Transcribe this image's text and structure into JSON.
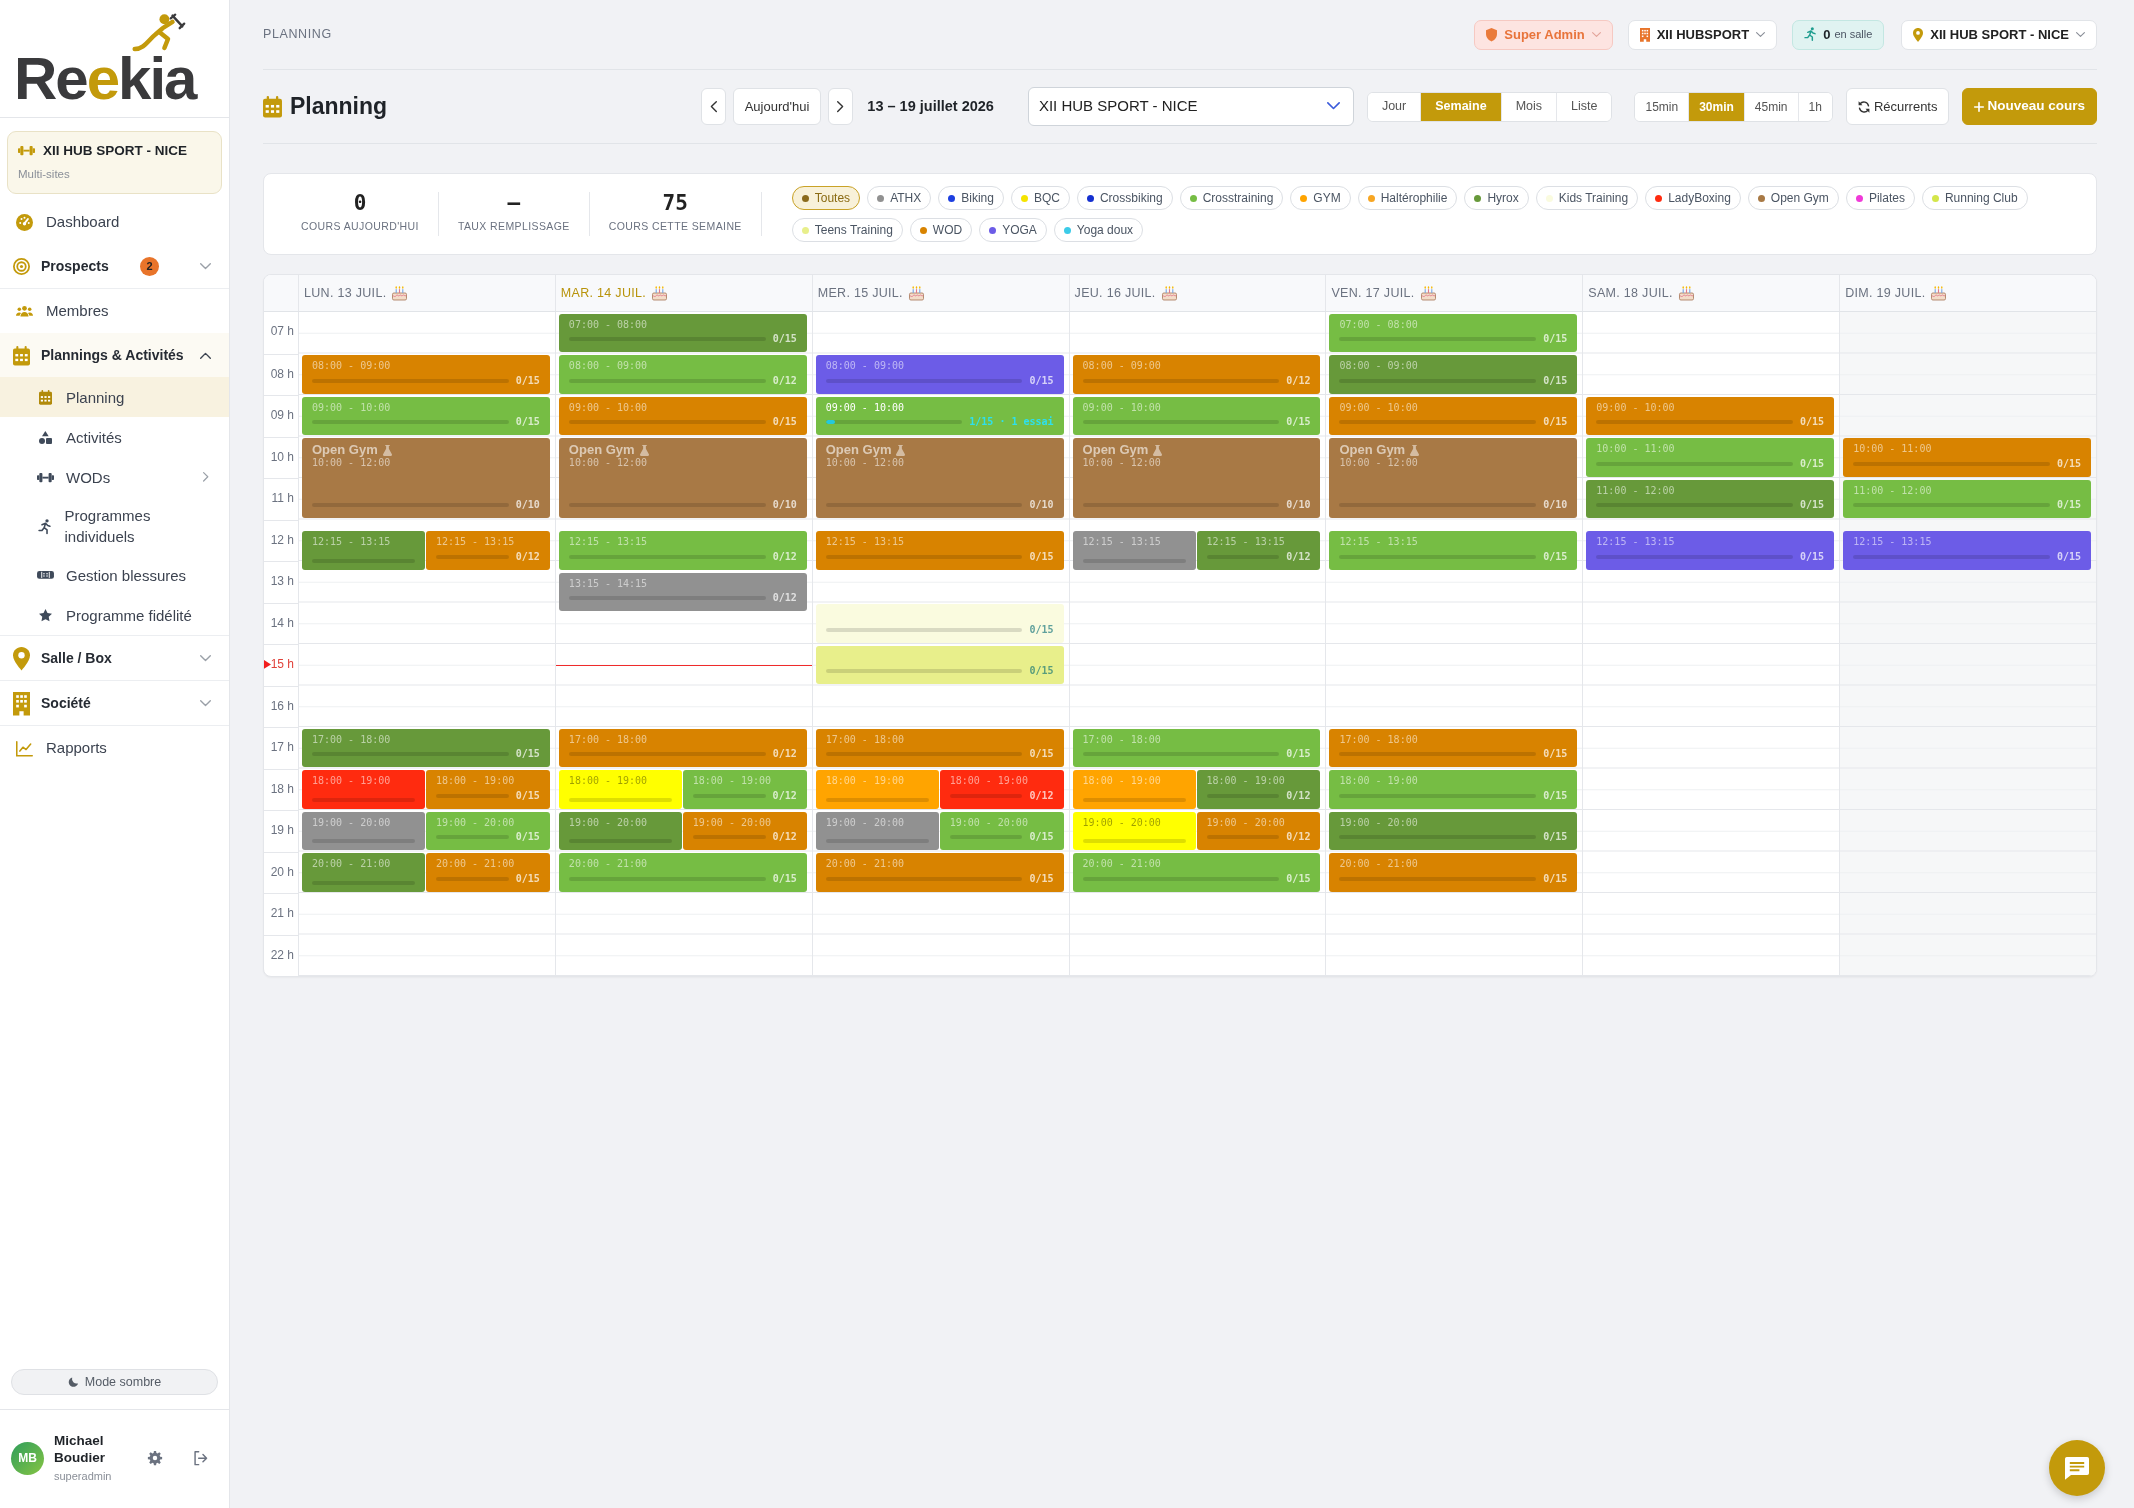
{
  "sidebar": {
    "logo": "Reekia",
    "site": {
      "name": "XII HUB SPORT - NICE",
      "subtitle": "Multi-sites"
    },
    "items": [
      {
        "kind": "link",
        "label": "Dashboard",
        "selected": false
      },
      {
        "kind": "group",
        "label": "Prospects",
        "badge": "2",
        "expanded": false,
        "selected": false
      },
      {
        "kind": "link",
        "label": "Membres",
        "selected": false
      },
      {
        "kind": "group",
        "label": "Plannings & Activités",
        "expanded": true,
        "selected": false,
        "children": [
          {
            "kind": "link",
            "label": "Planning",
            "selected": true
          },
          {
            "kind": "link",
            "label": "Activités",
            "selected": false
          },
          {
            "kind": "submenu",
            "label": "WODs",
            "selected": false
          },
          {
            "kind": "link",
            "label": "Programmes individuels",
            "selected": false
          },
          {
            "kind": "link",
            "label": "Gestion blessures",
            "selected": false
          },
          {
            "kind": "link",
            "label": "Programme fidélité",
            "selected": false
          }
        ]
      },
      {
        "kind": "group",
        "label": "Salle / Box",
        "expanded": false,
        "selected": false
      },
      {
        "kind": "group",
        "label": "Société",
        "expanded": false,
        "selected": false
      },
      {
        "kind": "link",
        "label": "Rapports",
        "selected": false
      }
    ],
    "dark_mode_button": "Mode sombre",
    "user": {
      "initials": "MB",
      "name": "Michael Boudier",
      "role": "superadmin"
    }
  },
  "topbar": {
    "breadcrumb": "PLANNING",
    "role": "Super Admin",
    "organization": "XII HUBSPORT",
    "presence": {
      "count": "0",
      "label": "en salle"
    },
    "site": "XII HUB SPORT - NICE"
  },
  "header": {
    "title": "Planning",
    "today_button": "Aujourd'hui",
    "range": "13 – 19 juillet 2026",
    "site_select": "XII HUB SPORT - NICE",
    "views": [
      {
        "label": "Jour",
        "selected": false
      },
      {
        "label": "Semaine",
        "selected": true
      },
      {
        "label": "Mois",
        "selected": false
      },
      {
        "label": "Liste",
        "selected": false
      }
    ],
    "intervals": [
      {
        "label": "15min",
        "selected": false
      },
      {
        "label": "30min",
        "selected": true
      },
      {
        "label": "45min",
        "selected": false
      },
      {
        "label": "1h",
        "selected": false
      }
    ],
    "recurring_button": "Récurrents",
    "new_button": "Nouveau cours"
  },
  "stats": [
    {
      "value": "0",
      "label": "COURS AUJOURD'HUI"
    },
    {
      "value": "–",
      "label": "TAUX REMPLISSAGE"
    },
    {
      "value": "75",
      "label": "COURS CETTE SEMAINE"
    }
  ],
  "filters": [
    {
      "label": "Toutes",
      "color": "#8a6a1c",
      "selected": true
    },
    {
      "label": "ATHX",
      "color": "#919191",
      "selected": false
    },
    {
      "label": "Biking",
      "color": "#1d3fe0",
      "selected": false
    },
    {
      "label": "BQC",
      "color": "#f5e400",
      "selected": false
    },
    {
      "label": "Crossbiking",
      "color": "#1530d0",
      "selected": false
    },
    {
      "label": "Crosstraining",
      "color": "#76bd44",
      "selected": false
    },
    {
      "label": "GYM",
      "color": "#ffa400",
      "selected": false
    },
    {
      "label": "Haltérophilie",
      "color": "#f7a623",
      "selected": false
    },
    {
      "label": "Hyrox",
      "color": "#67993a",
      "selected": false
    },
    {
      "label": "Kids Training",
      "color": "#fafbdf",
      "selected": false
    },
    {
      "label": "LadyBoxing",
      "color": "#ff2b0f",
      "selected": false
    },
    {
      "label": "Open Gym",
      "color": "#a87945",
      "selected": false
    },
    {
      "label": "Pilates",
      "color": "#f03ad8",
      "selected": false
    },
    {
      "label": "Running Club",
      "color": "#d4e64a",
      "selected": false
    },
    {
      "label": "Teens Training",
      "color": "#e8ef8b",
      "selected": false
    },
    {
      "label": "WOD",
      "color": "#d88300",
      "selected": false
    },
    {
      "label": "YOGA",
      "color": "#6c5ce7",
      "selected": false
    },
    {
      "label": "Yoga doux",
      "color": "#3ccbe8",
      "selected": false
    }
  ],
  "calendar": {
    "hours": [
      {
        "label": "07 h",
        "current": false
      },
      {
        "label": "08 h",
        "current": false
      },
      {
        "label": "09 h",
        "current": false
      },
      {
        "label": "10 h",
        "current": false
      },
      {
        "label": "11 h",
        "current": false
      },
      {
        "label": "12 h",
        "current": false
      },
      {
        "label": "13 h",
        "current": false
      },
      {
        "label": "14 h",
        "current": false
      },
      {
        "label": "15 h",
        "current": true
      },
      {
        "label": "16 h",
        "current": false
      },
      {
        "label": "17 h",
        "current": false
      },
      {
        "label": "18 h",
        "current": false
      },
      {
        "label": "19 h",
        "current": false
      },
      {
        "label": "20 h",
        "current": false
      },
      {
        "label": "21 h",
        "current": false
      },
      {
        "label": "22 h",
        "current": false
      }
    ],
    "days": [
      {
        "label": "LUN. 13 JUIL.",
        "today": false,
        "dimmed": false,
        "events": [
          {
            "color": "#d88300",
            "time": "08:00 - 09:00",
            "capacity": "0/15"
          },
          {
            "color": "#76bd44",
            "time": "09:00 - 10:00",
            "capacity": "0/15"
          },
          {
            "color": "#a87945",
            "title": "Open Gym",
            "time": "10:00 - 12:00",
            "capacity": "0/10"
          },
          {
            "color": "#67993a",
            "time": "12:15 - 13:15"
          },
          {
            "color": "#d88300",
            "time": "12:15 - 13:15",
            "capacity": "0/12"
          },
          {
            "color": "#67993a",
            "time": "17:00 - 18:00",
            "capacity": "0/15"
          },
          {
            "color": "#ff2b0f",
            "time": "18:00 - 19:00"
          },
          {
            "color": "#d88300",
            "time": "18:00 - 19:00",
            "capacity": "0/15"
          },
          {
            "color": "#919191",
            "time": "19:00 - 20:00"
          },
          {
            "color": "#76bd44",
            "time": "19:00 - 20:00",
            "capacity": "0/15"
          },
          {
            "color": "#67993a",
            "time": "20:00 - 21:00"
          },
          {
            "color": "#d88300",
            "time": "20:00 - 21:00",
            "capacity": "0/15"
          }
        ]
      },
      {
        "label": "MAR. 14 JUIL.",
        "today": true,
        "dimmed": false,
        "events": [
          {
            "color": "#67993a",
            "time": "07:00 - 08:00",
            "capacity": "0/15"
          },
          {
            "color": "#76bd44",
            "time": "08:00 - 09:00",
            "capacity": "0/12"
          },
          {
            "color": "#d88300",
            "time": "09:00 - 10:00",
            "capacity": "0/15"
          },
          {
            "color": "#a87945",
            "title": "Open Gym",
            "time": "10:00 - 12:00",
            "capacity": "0/10"
          },
          {
            "color": "#76bd44",
            "time": "12:15 - 13:15",
            "capacity": "0/12"
          },
          {
            "color": "#919191",
            "time": "13:15 - 14:15",
            "capacity": "0/12"
          },
          {
            "color": "#d88300",
            "time": "17:00 - 18:00",
            "capacity": "0/12"
          },
          {
            "color": "#ffff00",
            "time": "18:00 - 19:00"
          },
          {
            "color": "#76bd44",
            "time": "18:00 - 19:00",
            "capacity": "0/12"
          },
          {
            "color": "#67993a",
            "time": "19:00 - 20:00"
          },
          {
            "color": "#d88300",
            "time": "19:00 - 20:00",
            "capacity": "0/12"
          },
          {
            "color": "#76bd44",
            "time": "20:00 - 21:00",
            "capacity": "0/15"
          }
        ]
      },
      {
        "label": "MER. 15 JUIL.",
        "today": false,
        "dimmed": false,
        "events": [
          {
            "color": "#6c5ce7",
            "time": "08:00 - 09:00",
            "capacity": "0/15"
          },
          {
            "color": "#76bd44",
            "time": "09:00 - 10:00",
            "capacity": "1/15 · 1 essai",
            "level": 0.067
          },
          {
            "color": "#a87945",
            "title": "Open Gym",
            "time": "10:00 - 12:00",
            "capacity": "0/10"
          },
          {
            "color": "#d88300",
            "time": "12:15 - 13:15",
            "capacity": "0/15"
          },
          {
            "color": "#fafbdf",
            "capacity": "0/15"
          },
          {
            "color": "#e8ef8b",
            "capacity": "0/15"
          },
          {
            "color": "#d88300",
            "time": "17:00 - 18:00",
            "capacity": "0/15"
          },
          {
            "color": "#ffa400",
            "time": "18:00 - 19:00"
          },
          {
            "color": "#ff2b0f",
            "time": "18:00 - 19:00",
            "capacity": "0/12"
          },
          {
            "color": "#919191",
            "time": "19:00 - 20:00"
          },
          {
            "color": "#76bd44",
            "time": "19:00 - 20:00",
            "capacity": "0/15"
          },
          {
            "color": "#d88300",
            "time": "20:00 - 21:00",
            "capacity": "0/15"
          }
        ]
      },
      {
        "label": "JEU. 16 JUIL.",
        "today": false,
        "dimmed": false,
        "events": [
          {
            "color": "#d88300",
            "time": "08:00 - 09:00",
            "capacity": "0/12"
          },
          {
            "color": "#76bd44",
            "time": "09:00 - 10:00",
            "capacity": "0/15"
          },
          {
            "color": "#a87945",
            "title": "Open Gym",
            "time": "10:00 - 12:00",
            "capacity": "0/10"
          },
          {
            "color": "#919191",
            "time": "12:15 - 13:15"
          },
          {
            "color": "#67993a",
            "time": "12:15 - 13:15",
            "capacity": "0/12"
          },
          {
            "color": "#76bd44",
            "time": "17:00 - 18:00",
            "capacity": "0/15"
          },
          {
            "color": "#ffa400",
            "time": "18:00 - 19:00"
          },
          {
            "color": "#67993a",
            "time": "18:00 - 19:00",
            "capacity": "0/12"
          },
          {
            "color": "#ffff00",
            "time": "19:00 - 20:00"
          },
          {
            "color": "#d88300",
            "time": "19:00 - 20:00",
            "capacity": "0/12"
          },
          {
            "color": "#76bd44",
            "time": "20:00 - 21:00",
            "capacity": "0/15"
          }
        ]
      },
      {
        "label": "VEN. 17 JUIL.",
        "today": false,
        "dimmed": false,
        "events": [
          {
            "color": "#76bd44",
            "time": "07:00 - 08:00",
            "capacity": "0/15"
          },
          {
            "color": "#67993a",
            "time": "08:00 - 09:00",
            "capacity": "0/15"
          },
          {
            "color": "#d88300",
            "time": "09:00 - 10:00",
            "capacity": "0/15"
          },
          {
            "color": "#a87945",
            "title": "Open Gym",
            "time": "10:00 - 12:00",
            "capacity": "0/10"
          },
          {
            "color": "#76bd44",
            "time": "12:15 - 13:15",
            "capacity": "0/15"
          },
          {
            "color": "#d88300",
            "time": "17:00 - 18:00",
            "capacity": "0/15"
          },
          {
            "color": "#76bd44",
            "time": "18:00 - 19:00",
            "capacity": "0/15"
          },
          {
            "color": "#67993a",
            "time": "19:00 - 20:00",
            "capacity": "0/15"
          },
          {
            "color": "#d88300",
            "time": "20:00 - 21:00",
            "capacity": "0/15"
          }
        ]
      },
      {
        "label": "SAM. 18 JUIL.",
        "today": false,
        "dimmed": false,
        "events": [
          {
            "color": "#d88300",
            "time": "09:00 - 10:00",
            "capacity": "0/15"
          },
          {
            "color": "#76bd44",
            "time": "10:00 - 11:00",
            "capacity": "0/15"
          },
          {
            "color": "#67993a",
            "time": "11:00 - 12:00",
            "capacity": "0/15"
          },
          {
            "color": "#6c5ce7",
            "time": "12:15 - 13:15",
            "capacity": "0/15"
          }
        ]
      },
      {
        "label": "DIM. 19 JUIL.",
        "today": false,
        "dimmed": true,
        "events": [
          {
            "color": "#d88300",
            "time": "10:00 - 11:00",
            "capacity": "0/15"
          },
          {
            "color": "#76bd44",
            "time": "11:00 - 12:00",
            "capacity": "0/15"
          },
          {
            "color": "#6c5ce7",
            "time": "12:15 - 13:15",
            "capacity": "0/15"
          }
        ]
      }
    ]
  }
}
